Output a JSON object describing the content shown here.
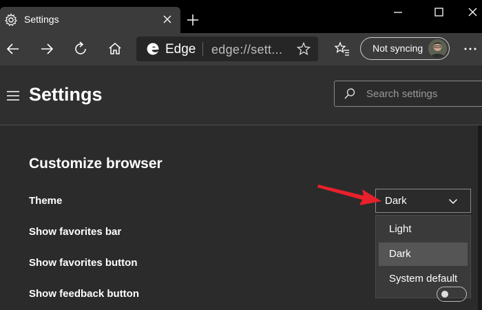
{
  "tab": {
    "title": "Settings"
  },
  "address": {
    "brand": "Edge",
    "url": "edge://sett..."
  },
  "sync": {
    "label": "Not syncing"
  },
  "header": {
    "title": "Settings",
    "search_placeholder": "Search settings"
  },
  "section": {
    "title": "Customize browser"
  },
  "rows": [
    {
      "label": "Theme"
    },
    {
      "label": "Show favorites bar"
    },
    {
      "label": "Show favorites button"
    },
    {
      "label": "Show feedback button"
    }
  ],
  "theme_dropdown": {
    "value": "Dark",
    "options": [
      "Light",
      "Dark",
      "System default"
    ],
    "selected": "Dark"
  },
  "colors": {
    "accent_arrow": "#e8202a",
    "bg_dark": "#2b2b2b",
    "toolbar": "#3b3b3b"
  }
}
